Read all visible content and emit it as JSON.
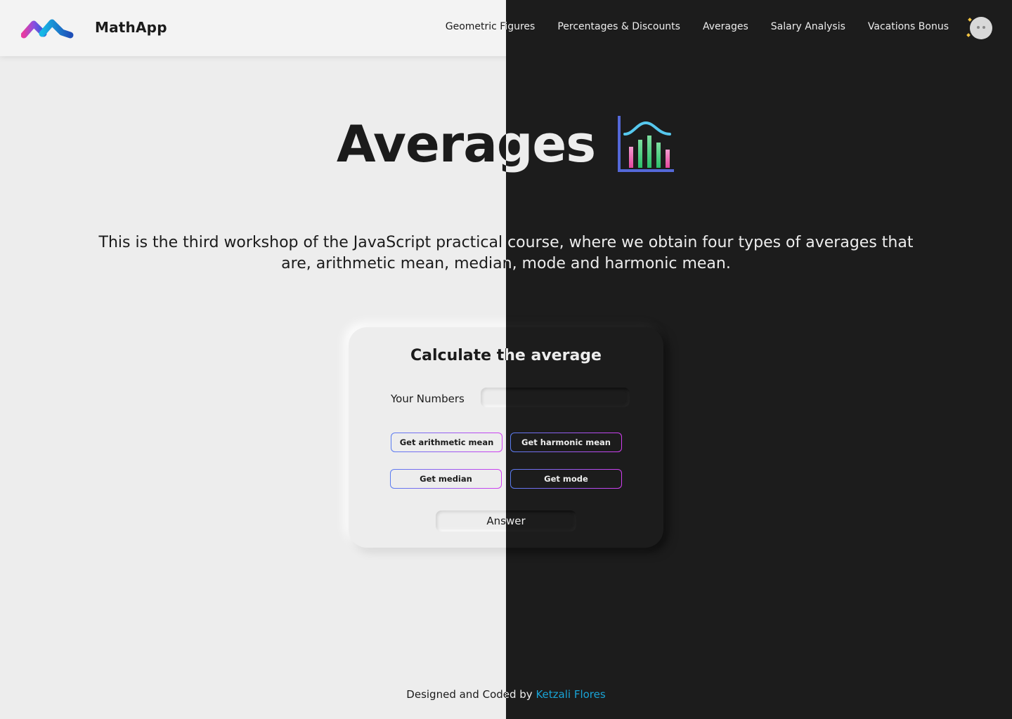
{
  "header": {
    "brand": "MathApp",
    "nav": [
      "Geometric Figures",
      "Percentages & Discounts",
      "Averages",
      "Salary Analysis",
      "Vacations Bonus"
    ]
  },
  "hero": {
    "title": "Averages",
    "icon": "bar-chart-bell-curve-icon",
    "description": "This is the third workshop of the JavaScript practical course, where we obtain four types of averages that are, arithmetic mean, median, mode and harmonic mean."
  },
  "card": {
    "title": "Calculate the average",
    "numbers_label": "Your Numbers",
    "numbers_value": "",
    "buttons": {
      "arithmetic": "Get arithmetic mean",
      "harmonic": "Get harmonic mean",
      "median": "Get median",
      "mode": "Get mode"
    },
    "answer": "Answer"
  },
  "footer": {
    "prefix": "Designed and Coded by",
    "author": "Ketzali Flores"
  },
  "colors": {
    "light_bg": "#ededed",
    "dark_bg": "#1c1c1c",
    "link": "#19a3d6",
    "button_gradient_start": "#5a7cf0",
    "button_gradient_end": "#d13ef0"
  }
}
